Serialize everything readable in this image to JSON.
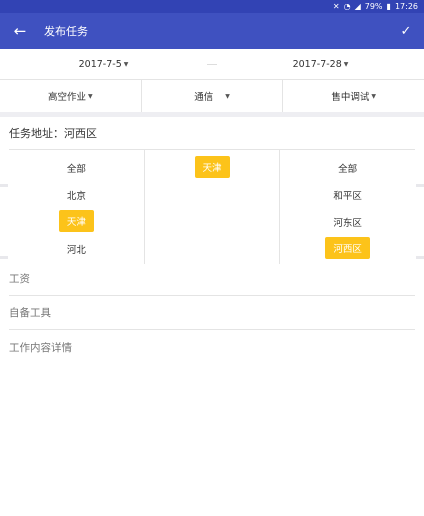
{
  "status_bar": {
    "battery": "79%",
    "time": "17:26"
  },
  "app_bar": {
    "title": "发布任务"
  },
  "dates": {
    "start": "2017-7-5",
    "end": "2017-7-28"
  },
  "filters": [
    {
      "label": "高空作业"
    },
    {
      "label": "通信"
    },
    {
      "label": "售中调试"
    }
  ],
  "address": {
    "label": "任务地址：",
    "value": "河西区"
  },
  "picker": {
    "provinces": [
      "全部",
      "北京",
      "天津",
      "河北"
    ],
    "selected_province_index": 2,
    "cities": [
      "天津"
    ],
    "selected_city_index": 0,
    "districts": [
      "全部",
      "和平区",
      "河东区",
      "河西区"
    ],
    "selected_district_index": 3
  },
  "fields": {
    "salary_placeholder": "工资",
    "tools_placeholder": "自备工具",
    "detail_placeholder": "工作内容详情"
  },
  "colors": {
    "primary": "#3f51c0",
    "status": "#3243b4",
    "accent": "#fcc31a"
  }
}
